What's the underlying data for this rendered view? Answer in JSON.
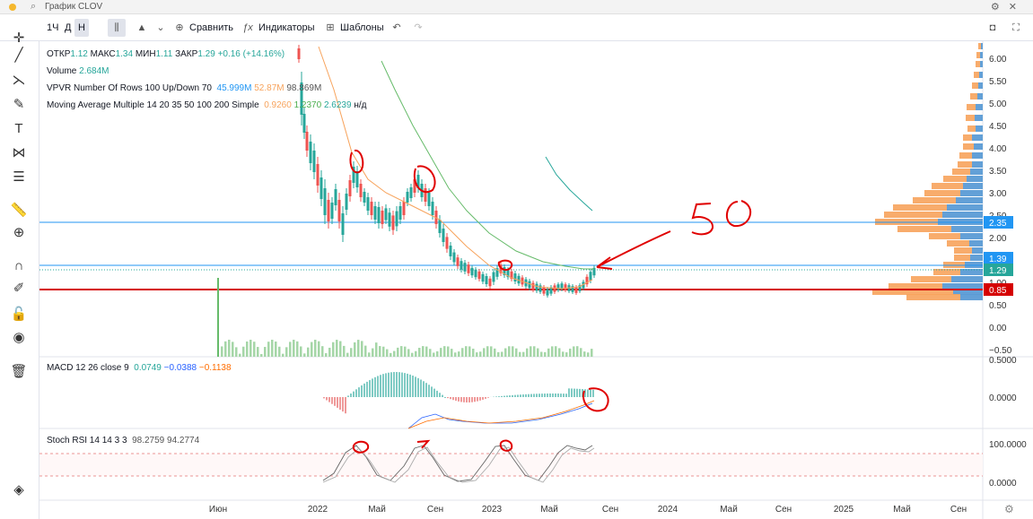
{
  "window": {
    "title": "График CLOV",
    "search_icon": "search-icon",
    "controls": "gear / close"
  },
  "toolbar": {
    "interval": "1Ч",
    "d": "Д",
    "h": "Н",
    "compare": "Сравнить",
    "indicators": "Индикаторы",
    "templates": "Шаблоны"
  },
  "legend": {
    "ohlc": {
      "open_label": "ОТКР",
      "open": "1.12",
      "high_label": "МАКС",
      "high": "1.34",
      "low_label": "МИН",
      "low": "1.11",
      "close_label": "ЗАКР",
      "close": "1.29",
      "change": "+0.16 (+14.16%)"
    },
    "volume": {
      "label": "Volume",
      "value": "2.684M"
    },
    "vpvr": {
      "label": "VPVR Number Of Rows 100 Up/Down 70",
      "up": "45.999M",
      "down": "52.87M",
      "total": "98.869M"
    },
    "ma": {
      "label": "Moving Average Multiple 14 20 35 50 100 200 Simple",
      "v1": "0.9260",
      "v2": "1.2370",
      "v3": "2.6239",
      "v4": "н/д"
    }
  },
  "macd": {
    "label": "MACD 12 26 close 9",
    "v1": "0.0749",
    "v2": "−0.0388",
    "v3": "−0.1138",
    "scale": [
      "0.5000",
      "0.0000"
    ]
  },
  "stoch": {
    "label": "Stoch RSI 14 14 3 3",
    "v1": "98.2759",
    "v2": "94.2774",
    "scale": [
      "100.0000",
      "0.0000"
    ]
  },
  "price_scale": [
    "6.00",
    "5.50",
    "5.00",
    "4.50",
    "4.00",
    "3.50",
    "3.00",
    "2.50",
    "2.00",
    "1.50",
    "1.00",
    "0.50",
    "0.00",
    "−0.50"
  ],
  "price_badges": [
    {
      "label": "2.35",
      "color": "#2196f3"
    },
    {
      "label": "1.39",
      "color": "#2196f3"
    },
    {
      "label": "1.29",
      "color": "#26a69a"
    },
    {
      "label": "0.85",
      "color": "#d50000"
    }
  ],
  "time_axis": [
    "Июн",
    "2022",
    "Май",
    "Сен",
    "2023",
    "Май",
    "Сен",
    "2024",
    "Май",
    "Сен",
    "2025",
    "Май",
    "Сен"
  ],
  "annotation": {
    "text": "50"
  },
  "colors": {
    "up": "#26a69a",
    "down": "#ef5350",
    "ma_orange": "#f7a35c",
    "ma_green": "#4caf50",
    "hline_red": "#d50000",
    "hline_blue": "#2196f3"
  }
}
